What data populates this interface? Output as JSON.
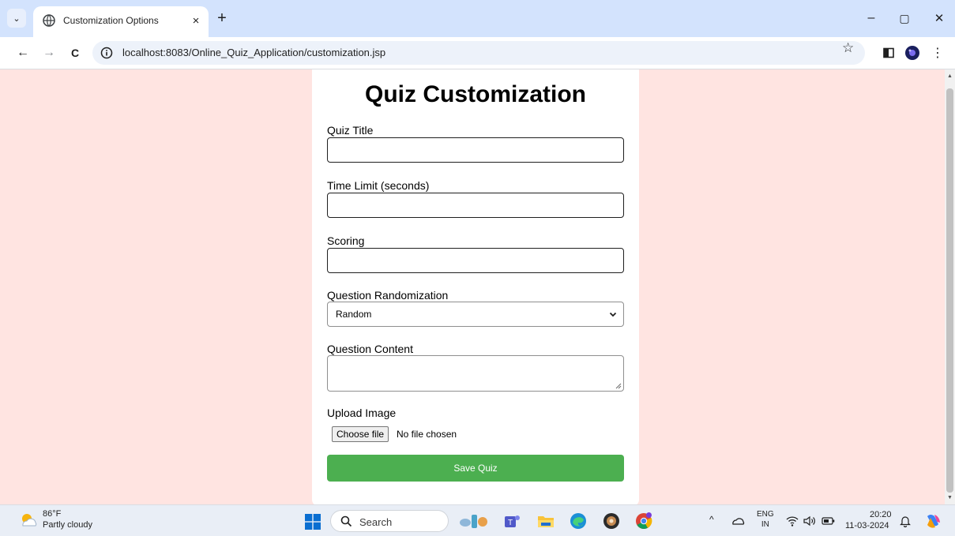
{
  "browser": {
    "tab": {
      "title": "Customization Options",
      "close_glyph": "×"
    },
    "new_tab_glyph": "+",
    "window": {
      "minimize_glyph": "–",
      "restore_glyph": "▢",
      "close_glyph": "✕"
    },
    "nav": {
      "back_glyph": "←",
      "forward_glyph": "→",
      "reload_glyph": "C"
    },
    "url": "localhost:8083/Online_Quiz_Application/customization.jsp",
    "bookmark_glyph": "☆"
  },
  "page": {
    "title": "Quiz Customization",
    "fields": {
      "quiz_title": {
        "label": "Quiz Title",
        "value": ""
      },
      "time_limit": {
        "label": "Time Limit (seconds)",
        "value": ""
      },
      "scoring": {
        "label": "Scoring",
        "value": ""
      },
      "randomization": {
        "label": "Question Randomization",
        "selected": "Random"
      },
      "question_content": {
        "label": "Question Content",
        "value": ""
      },
      "upload_image": {
        "label": "Upload Image",
        "button": "Choose file",
        "status": "No file chosen"
      }
    },
    "save_button": "Save Quiz",
    "colors": {
      "background": "#ffe4e1",
      "save_button": "#4caf50"
    }
  },
  "taskbar": {
    "weather": {
      "temp": "86°F",
      "desc": "Partly cloudy"
    },
    "search": "Search",
    "tray": {
      "lang_line1": "ENG",
      "lang_line2": "IN",
      "time": "20:20",
      "date": "11-03-2024"
    },
    "apps": [
      "widgets-icon",
      "teams-icon",
      "file-explorer-icon",
      "edge-icon",
      "app-icon",
      "chrome-icon"
    ]
  }
}
